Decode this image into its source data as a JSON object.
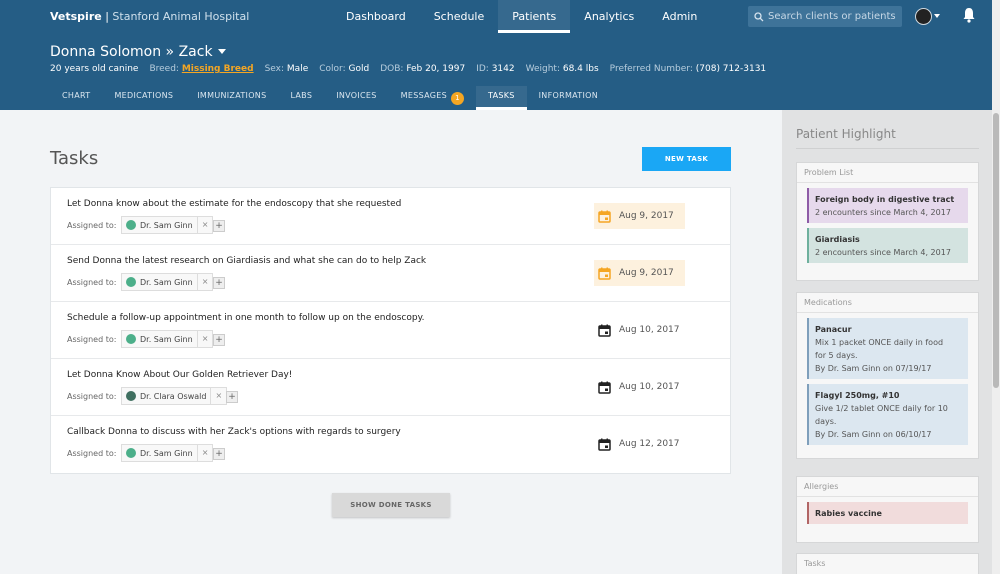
{
  "brand": {
    "name": "Vetspire",
    "sep": " | ",
    "hospital": "Stanford Animal Hospital"
  },
  "topnav": [
    "Dashboard",
    "Schedule",
    "Patients",
    "Analytics",
    "Admin"
  ],
  "search": {
    "placeholder": "Search clients or patients"
  },
  "patient": {
    "owner": "Donna Solomon »",
    "name": "Zack",
    "info": {
      "age": "20 years old canine",
      "breed_label": "Breed:",
      "breed": "Missing Breed",
      "sex_label": "Sex:",
      "sex": "Male",
      "color_label": "Color:",
      "color": "Gold",
      "dob_label": "DOB:",
      "dob": "Feb 20, 1997",
      "id_label": "ID:",
      "id": "3142",
      "weight_label": "Weight:",
      "weight": "68.4 lbs",
      "phone_label": "Preferred Number:",
      "phone": "(708) 712-3131"
    }
  },
  "subnav": [
    "CHART",
    "MEDICATIONS",
    "IMMUNIZATIONS",
    "LABS",
    "INVOICES",
    "MESSAGES",
    "TASKS",
    "INFORMATION"
  ],
  "messages_badge": "1",
  "tasks": {
    "title": "Tasks",
    "new_task": "NEW TASK",
    "assigned_label": "Assigned to:",
    "remove": "×",
    "add": "+",
    "items": [
      {
        "text": "Let Donna know about the estimate for the endoscopy that she requested",
        "assignee": "Dr. Sam Ginn",
        "due": "Aug 9, 2017"
      },
      {
        "text": "Send Donna the latest research on Giardiasis and what she can do to help Zack",
        "assignee": "Dr. Sam Ginn",
        "due": "Aug 9, 2017"
      },
      {
        "text": "Schedule a follow-up appointment in one month to follow up on the endoscopy.",
        "assignee": "Dr. Sam Ginn",
        "due": "Aug 10, 2017"
      },
      {
        "text": "Let Donna Know About Our Golden Retriever Day!",
        "assignee": "Dr. Clara Oswald",
        "due": "Aug 10, 2017"
      },
      {
        "text": "Callback Donna to discuss with her Zack's options with regards to surgery",
        "assignee": "Dr. Sam Ginn",
        "due": "Aug 12, 2017"
      }
    ],
    "show_done": "SHOW DONE TASKS"
  },
  "highlight": {
    "title": "Patient Highlight",
    "problem_list": {
      "header": "Problem List",
      "items": [
        {
          "title": "Foreign body in digestive tract",
          "line": "2 encounters since March 4, 2017"
        },
        {
          "title": "Giardiasis",
          "line": "2 encounters since March 4, 2017"
        }
      ]
    },
    "medications": {
      "header": "Medications",
      "items": [
        {
          "title": "Panacur",
          "line1": "Mix 1 packet ONCE daily in food",
          "line2": "for 5 days.",
          "line3": "By Dr. Sam Ginn on 07/19/17"
        },
        {
          "title": "Flagyl 250mg, #10",
          "line1": "Give 1/2 tablet ONCE daily for 10",
          "line2": "days.",
          "line3": "By Dr. Sam Ginn on 06/10/17"
        }
      ]
    },
    "allergies": {
      "header": "Allergies",
      "items": [
        {
          "title": "Rabies vaccine"
        }
      ]
    },
    "tasks_header": "Tasks"
  },
  "colors": {
    "header": "#255d85",
    "accent": "#1aa7f5",
    "warning": "#f5a623"
  },
  "icons": [
    "search-icon",
    "avatar",
    "bell-icon",
    "calendar-icon",
    "caret-down-icon"
  ]
}
